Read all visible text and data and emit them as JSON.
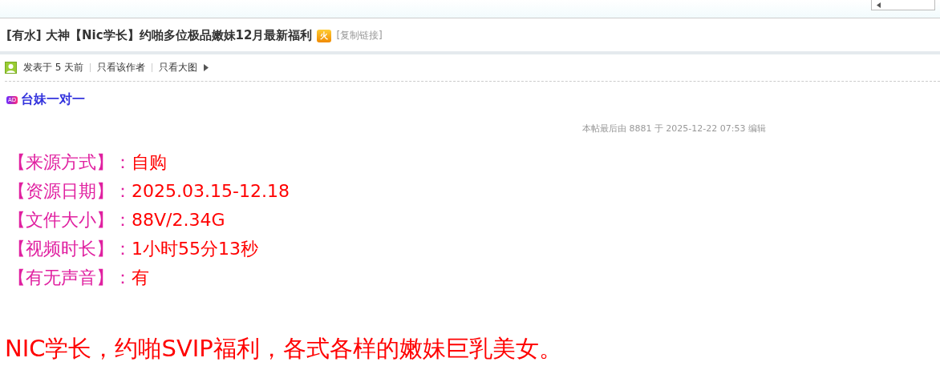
{
  "title": {
    "tag": "[有水]",
    "text": "大神【Nic学长】约啪多位极品嫩妹12月最新福利",
    "badge": "火",
    "copy_link": "[复制链接]"
  },
  "meta": {
    "posted": "发表于 5 天前",
    "links": [
      "只看该作者",
      "只看大图"
    ]
  },
  "ad": {
    "badge": "AD",
    "text": "台妹一对一"
  },
  "edit_note": "本帖最后由 8881 于 2025-12-22 07:53 编辑",
  "fields": [
    {
      "label": "【来源方式】：",
      "value": "自购"
    },
    {
      "label": "【资源日期】：",
      "value": "2025.03.15-12.18"
    },
    {
      "label": "【文件大小】：",
      "value": "88V/2.34G"
    },
    {
      "label": "【视频时长】：",
      "value": "1小时55分13秒"
    },
    {
      "label": "【有无声音】：",
      "value": "有"
    }
  ],
  "summary": "NIC学长，约啪SVIP福利，各式各样的嫩妹巨乳美女。"
}
